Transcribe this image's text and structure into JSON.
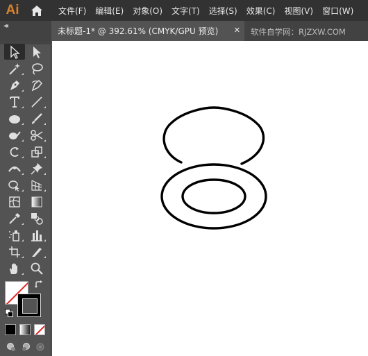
{
  "app": {
    "logo": "Ai"
  },
  "menu": [
    "文件(F)",
    "编辑(E)",
    "对象(O)",
    "文字(T)",
    "选择(S)",
    "效果(C)",
    "视图(V)",
    "窗口(W)"
  ],
  "tab": {
    "title": "未标题-1* @ 392.61% (CMYK/GPU 预览)",
    "close": "✕"
  },
  "watermark": "软件自学网：RJZXW.COM",
  "panel": {
    "collapse": "◂◂"
  },
  "colors": {
    "menubar": "#323232",
    "panel": "#535353",
    "canvas": "#ffffff",
    "logo": "#d9822b",
    "stroke": "#000000"
  }
}
